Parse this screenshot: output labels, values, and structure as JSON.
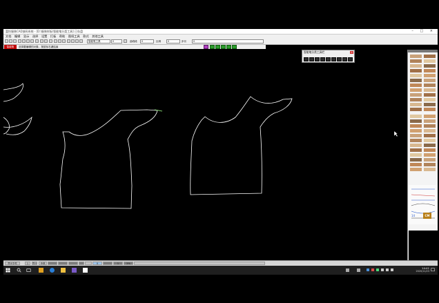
{
  "window": {
    "title": "富怡服装CAD放码系统 - [D:\\服装样板\\智能笔分类工具] 已存盘",
    "controls": "– □ ×"
  },
  "menu": [
    "文档",
    "编辑",
    "显示",
    "选择",
    "设置",
    "打板",
    "帮助",
    "图纸工具",
    "款式",
    "其他工具"
  ],
  "toolbar": {
    "style_select": "智能笔工具",
    "field_a": "0",
    "label_line_width": "曲线段",
    "field_line_width": "0",
    "label_scale": "比例",
    "field_scale": "0",
    "label_step": "步长",
    "field_step": "0"
  },
  "prompt": {
    "command": "智能笔",
    "message": "选择要编辑的对象，按鼠标右键结束"
  },
  "float_panel": {
    "title": "智能笔分类工具栏",
    "close": "×",
    "buttons": [
      "line-tool-icon",
      "curve-tool-icon",
      "corner-tool-icon",
      "dart-tool-icon",
      "pleat-tool-icon",
      "notch-tool-icon",
      "mirror-tool-icon",
      "rotate-tool-icon",
      "measure-tool-icon"
    ]
  },
  "right_panel": {
    "badge": "CM",
    "count": "14"
  },
  "statusbar": {
    "cells": [
      "显示文件",
      "1",
      "显示",
      "全部",
      "",
      "",
      "",
      "",
      "",
      "0",
      "",
      "1",
      "2%",
      ""
    ]
  },
  "taskbar": {
    "time": "14:41",
    "date": "2020/11/23"
  },
  "colors": {
    "pattern_line": "#ffffff",
    "selected_line": "#7cc96b",
    "command_red": "#c00000",
    "toolbar_green": "#2a9d2a"
  }
}
